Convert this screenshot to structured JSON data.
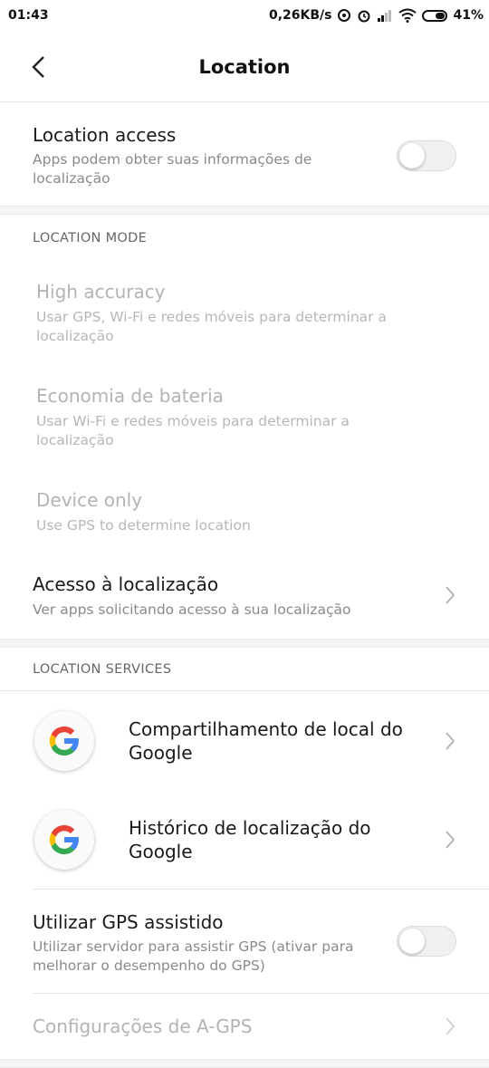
{
  "status_bar": {
    "time": "01:43",
    "network_speed": "0,26KB/s",
    "battery": "41%"
  },
  "header": {
    "title": "Location"
  },
  "location_access": {
    "title": "Location access",
    "subtitle": "Apps podem obter suas informações de localização",
    "enabled": false
  },
  "location_mode": {
    "label": "LOCATION MODE",
    "options": [
      {
        "title": "High accuracy",
        "subtitle": "Usar GPS, Wi-Fi e redes móveis para determinar a localização"
      },
      {
        "title": "Economia de bateria",
        "subtitle": "Usar Wi-Fi e redes móveis para determinar a localização"
      },
      {
        "title": "Device only",
        "subtitle": "Use GPS to determine location"
      }
    ]
  },
  "location_requests": {
    "title": "Acesso à localização",
    "subtitle": "Ver apps solicitando acesso à sua localização"
  },
  "location_services": {
    "label": "LOCATION SERVICES",
    "items": [
      {
        "title": "Compartilhamento de local do Google",
        "icon": "google-icon"
      },
      {
        "title": "Histórico de localização do Google",
        "icon": "google-icon"
      }
    ]
  },
  "assisted_gps": {
    "title": "Utilizar GPS assistido",
    "subtitle": "Utilizar servidor para assistir GPS (ativar para melhorar o desempenho do GPS)",
    "enabled": false
  },
  "agps_settings": {
    "title": "Configurações de A-GPS"
  }
}
